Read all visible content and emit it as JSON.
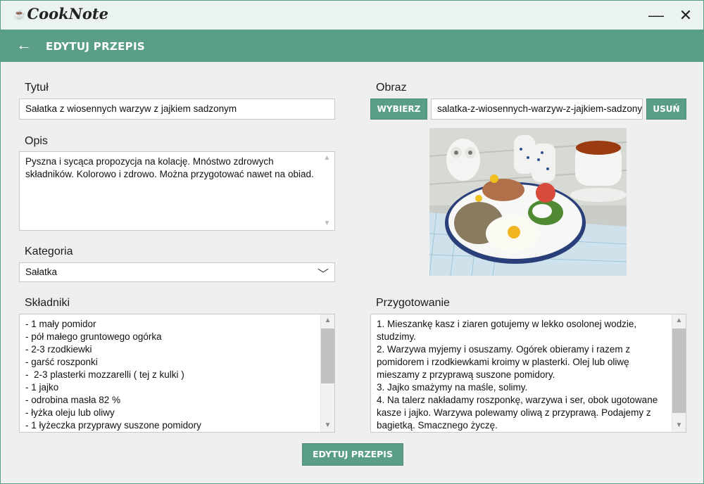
{
  "app": {
    "name": "CookNote"
  },
  "window": {
    "minimize_label": "—",
    "close_label": "✕"
  },
  "header": {
    "title": "EDYTUJ PRZEPIS",
    "back_glyph": "←"
  },
  "form": {
    "title_label": "Tytuł",
    "title_value": "Sałatka z wiosennych warzyw z jajkiem sadzonym",
    "description_label": "Opis",
    "description_value": "Pyszna i sycąca propozycja na kolację. Mnóstwo zdrowych składników. Kolorowo i zdrowo. Można przygotować nawet na obiad.",
    "category_label": "Kategoria",
    "category_value": "Sałatka",
    "ingredients_label": "Składniki",
    "ingredients_value": "- 1 mały pomidor\n- pół małego gruntowego ogórka\n- 2-3 rzodkiewki\n- garść roszponki\n-  2-3 plasterki mozzarelli ( tej z kulki )\n- 1 jajko\n- odrobina masła 82 %\n- łyżka oleju lub oliwy\n- 1 łyżeczka przyprawy suszone pomidory",
    "image_label": "Obraz",
    "choose_button": "WYBIERZ",
    "image_filename": "salatka-z-wiosennych-warzyw-z-jajkiem-sadzonym.jpg",
    "remove_button": "USUŃ",
    "preparation_label": "Przygotowanie",
    "preparation_value": "1. Mieszankę kasz i ziaren gotujemy w lekko osolonej wodzie, studzimy.\n2. Warzywa myjemy i osuszamy. Ogórek obieramy i razem z pomidorem i rzodkiewkami kroimy w plasterki. Olej lub oliwę mieszamy z przyprawą suszone pomidory.\n3. Jajko smażymy na maśle, solimy.\n4. Na talerz nakładamy roszponkę, warzywa i ser, obok ugotowane kasze i jajko. Warzywa polewamy oliwą z przyprawą. Podajemy z bagietką. Smacznego życzę.",
    "submit_button": "EDYTUJ PRZEPIS"
  },
  "colors": {
    "accent": "#5a9e85",
    "background": "#efefef",
    "titlebar": "#eaf3ef"
  }
}
